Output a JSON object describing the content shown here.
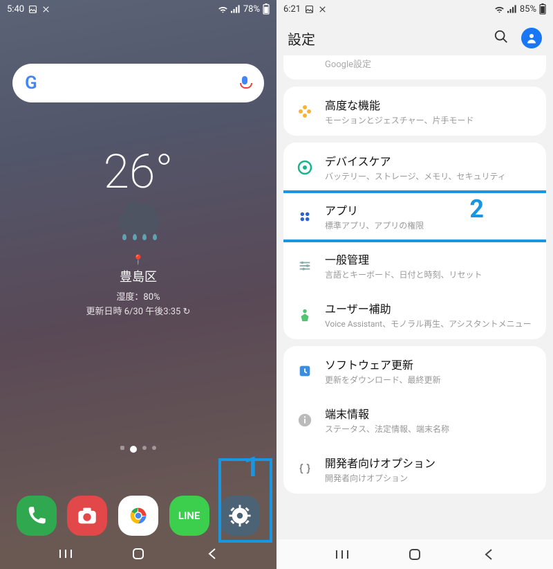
{
  "left": {
    "status": {
      "time": "5:40",
      "battery": "78%"
    },
    "weather": {
      "temp": "26°",
      "location": "豊島区",
      "humidity": "湿度：80%",
      "updated": "更新日時 6/30 午後3:35 ↻"
    },
    "dock": {
      "line_label": "LINE"
    },
    "annotation": "1"
  },
  "right": {
    "status": {
      "time": "6:21",
      "battery": "85%"
    },
    "title": "設定",
    "cut_row": "Google設定",
    "groups": [
      {
        "items": [
          {
            "id": "advanced",
            "title": "高度な機能",
            "sub": "モーションとジェスチャー、片手モード",
            "icon": "flower",
            "color": "#f6b33c"
          }
        ]
      },
      {
        "items": [
          {
            "id": "device-care",
            "title": "デバイスケア",
            "sub": "バッテリー、ストレージ、メモリ、セキュリティ",
            "icon": "devicecare",
            "color": "#17b58a"
          },
          {
            "id": "apps",
            "title": "アプリ",
            "sub": "標準アプリ、アプリの権限",
            "icon": "dots4",
            "color": "#2e64d1",
            "highlight": true,
            "annotation": "2"
          },
          {
            "id": "general",
            "title": "一般管理",
            "sub": "言語とキーボード、日付と時刻、リセット",
            "icon": "sliders",
            "color": "#8aa"
          },
          {
            "id": "accessibility",
            "title": "ユーザー補助",
            "sub": "Voice Assistant、モノラル再生、アシスタントメニュー",
            "icon": "person",
            "color": "#56c374"
          }
        ]
      },
      {
        "items": [
          {
            "id": "software-update",
            "title": "ソフトウェア更新",
            "sub": "更新をダウンロード、最終更新",
            "icon": "update",
            "color": "#3a8de0"
          },
          {
            "id": "about",
            "title": "端末情報",
            "sub": "ステータス、法定情報、端末名称",
            "icon": "info",
            "color": "#bbb"
          },
          {
            "id": "developer",
            "title": "開発者向けオプション",
            "sub": "開発者向けオプション",
            "icon": "braces",
            "color": "#888"
          }
        ]
      }
    ]
  }
}
